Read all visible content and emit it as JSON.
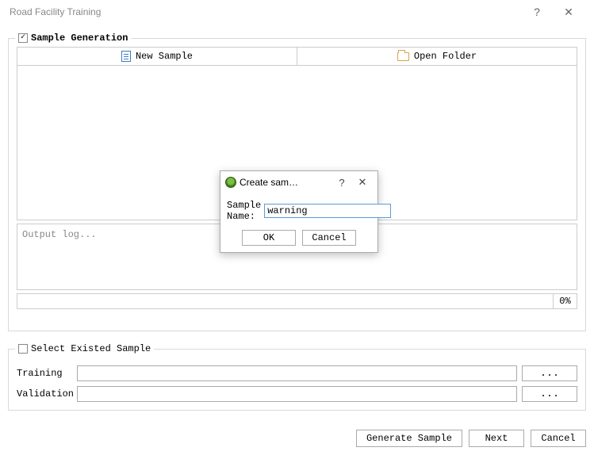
{
  "window": {
    "title": "Road Facility Training",
    "help_symbol": "?",
    "close_symbol": "✕"
  },
  "sample_generation": {
    "title": "Sample Generation",
    "checked": true,
    "check_symbol": "✓",
    "new_sample_label": "New Sample",
    "open_folder_label": "Open Folder",
    "output_log_placeholder": "Output log...",
    "progress_label": "0%"
  },
  "select_existed": {
    "title": "Select Existed Sample",
    "checked": false,
    "training_label": "Training",
    "validation_label": "Validation",
    "training_value": "",
    "validation_value": "",
    "browse_label": "..."
  },
  "footer": {
    "generate_label": "Generate Sample",
    "next_label": "Next",
    "cancel_label": "Cancel"
  },
  "modal": {
    "title": "Create sam…",
    "help_symbol": "?",
    "close_symbol": "✕",
    "field_label": "Sample Name:",
    "field_value": "warning",
    "ok_label": "OK",
    "cancel_label": "Cancel"
  }
}
